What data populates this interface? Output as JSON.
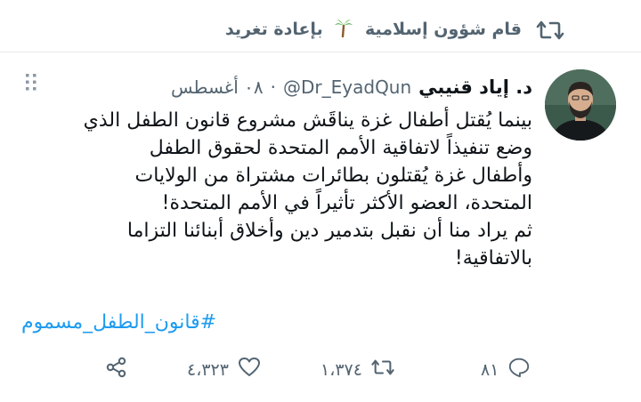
{
  "retweet_header": {
    "text_before_icon": "قام شؤون إسلامية",
    "icon": "palm-tree-emoji",
    "text_after_icon": "بإعادة تغريد",
    "icon_name": "retweet-icon"
  },
  "author": {
    "display_name": "د. إياد قنيبي",
    "handle": "@Dr_EyadQun",
    "separator": "·",
    "date": "٠٨ أغسطس"
  },
  "tweet": {
    "lines": [
      "بينما يُقتل أطفال غزة يناقَش مشروع قانون الطفل الذي",
      "وضع تنفيذاً لاتفاقية الأمم المتحدة لحقوق الطفل",
      "وأطفال غزة يُقتلون بطائرات مشتراة من الولايات",
      "المتحدة، العضو الأكثر تأثيراً في الأمم المتحدة!",
      "ثم يراد منا أن نقبل بتدمير دين وأخلاق أبنائنا التزاما",
      "بالاتفاقية!"
    ],
    "hashtag": "#قانون_الطفل_مسموم"
  },
  "actions": {
    "reply_count": "٨١",
    "retweet_count": "١،٣٧٤",
    "like_count": "٤،٣٢٣"
  },
  "colors": {
    "muted": "#536471",
    "text": "#0f1419",
    "link": "#1d9bf0"
  }
}
